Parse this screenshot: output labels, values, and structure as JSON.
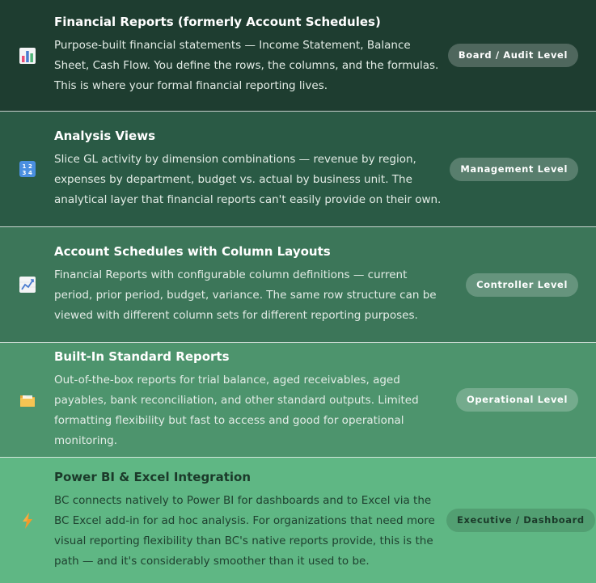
{
  "rows": [
    {
      "title": "Financial Reports (formerly Account Schedules)",
      "description": "Purpose-built financial statements — Income Statement, Balance Sheet, Cash Flow. You define the rows, the columns, and the formulas. This is where your formal financial reporting lives.",
      "badge": "Board / Audit Level",
      "icon": "bar-chart-icon"
    },
    {
      "title": "Analysis Views",
      "description": "Slice GL activity by dimension combinations — revenue by region, expenses by department, budget vs. actual by business unit. The analytical layer that financial reports can't easily provide on their own.",
      "badge": "Management Level",
      "icon": "numbers-icon"
    },
    {
      "title": "Account Schedules with Column Layouts",
      "description": "Financial Reports with configurable column definitions — current period, prior period, budget, variance. The same row structure can be viewed with different column sets for different reporting purposes.",
      "badge": "Controller Level",
      "icon": "trending-up-chart-icon"
    },
    {
      "title": "Built-In Standard Reports",
      "description": "Out-of-the-box reports for trial balance, aged receivables, aged payables, bank reconciliation, and other standard outputs. Limited formatting flexibility but fast to access and good for operational monitoring.",
      "badge": "Operational Level",
      "icon": "folder-icon"
    },
    {
      "title": "Power BI & Excel Integration",
      "description": "BC connects natively to Power BI for dashboards and to Excel via the BC Excel add-in for ad hoc analysis. For organizations that need more visual reporting flexibility than BC's native reports provide, this is the path — and it's considerably smoother than it used to be.",
      "badge": "Executive / Dashboard",
      "icon": "lightning-icon"
    }
  ]
}
